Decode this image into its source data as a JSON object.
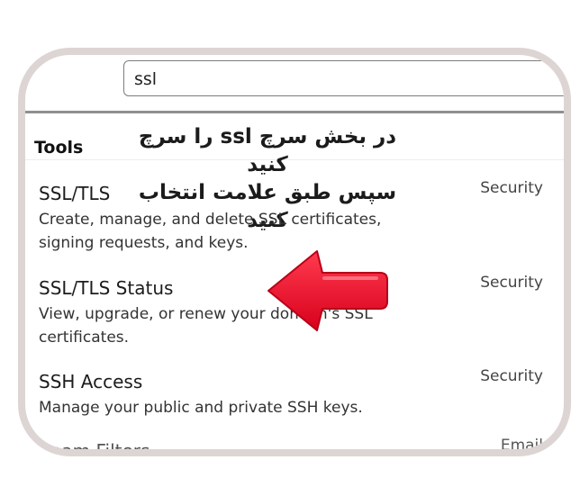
{
  "search": {
    "value": "ssl"
  },
  "section": {
    "title": "Tools"
  },
  "annotation": {
    "line1": "در بخش سرچ ssl را سرچ کنید",
    "line2": "سپس طبق علامت انتخاب کنید"
  },
  "results": [
    {
      "title": "SSL/TLS",
      "desc": "Create, manage, and delete SSL certificates, signing requests, and keys.",
      "category": "Security"
    },
    {
      "title": "SSL/TLS Status",
      "desc": "View, upgrade, or renew your domain's SSL certificates.",
      "category": "Security"
    },
    {
      "title": "SSH Access",
      "desc": "Manage your public and private SSH keys.",
      "category": "Security"
    },
    {
      "title": "Spam Filters",
      "desc": "",
      "category": "Email"
    }
  ],
  "colors": {
    "arrow": "#ff0a2a",
    "frame": "#ddd5d4"
  }
}
